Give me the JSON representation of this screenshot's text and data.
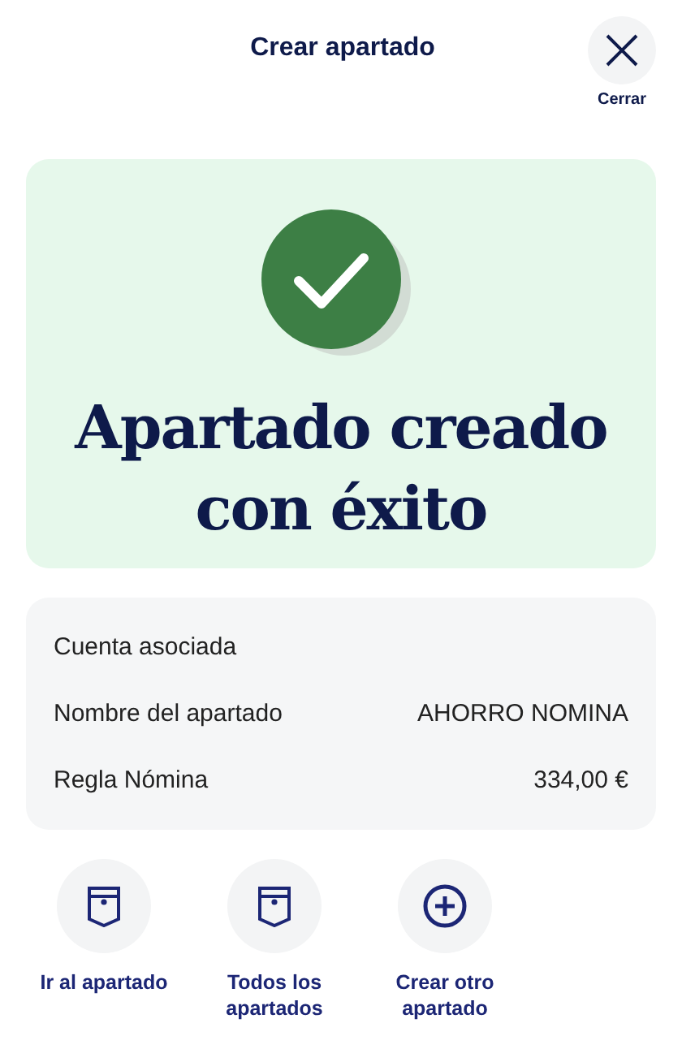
{
  "header": {
    "title": "Crear apartado",
    "close_label": "Cerrar"
  },
  "success": {
    "heading": "Apartado creado con éxito"
  },
  "details": [
    {
      "label": "Cuenta asociada"
    },
    {
      "label": "Nombre del apartado",
      "value": "AHORRO NOMINA"
    },
    {
      "label": "Regla Nómina",
      "value": "334,00 €"
    }
  ],
  "actions": [
    {
      "kind": "pocket",
      "label": "Ir al apartado"
    },
    {
      "kind": "pocket",
      "label": "Todos los apartados"
    },
    {
      "kind": "plus",
      "label": "Crear otro apartado"
    }
  ]
}
